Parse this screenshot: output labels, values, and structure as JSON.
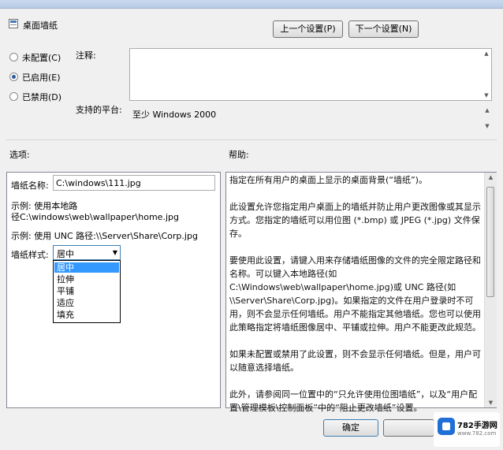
{
  "header": {
    "setting_title": "桌面墙纸",
    "prev_button": "上一个设置(P)",
    "next_button": "下一个设置(N)"
  },
  "state": {
    "not_configured": "未配置(C)",
    "enabled": "已启用(E)",
    "disabled": "已禁用(D)",
    "selected": "enabled"
  },
  "comment": {
    "label": "注释:",
    "value": ""
  },
  "platform": {
    "label": "支持的平台:",
    "value": "至少 Windows 2000"
  },
  "options": {
    "label": "选项:",
    "wallpaper_name_label": "墙纸名称:",
    "wallpaper_name_value": "C:\\windows\\111.jpg",
    "example_local_line1": "示例: 使用本地路",
    "example_local_line2": "径C:\\windows\\web\\wallpaper\\home.jpg",
    "example_unc": "示例: 使用 UNC 路径:\\\\Server\\Share\\Corp.jpg",
    "style_label": "墙纸样式:",
    "style_value": "居中",
    "style_options": [
      "居中",
      "拉伸",
      "平铺",
      "适应",
      "填充"
    ]
  },
  "help": {
    "label": "帮助:",
    "paragraphs": [
      "指定在所有用户的桌面上显示的桌面背景(“墙纸”)。",
      "此设置允许您指定用户桌面上的墙纸并防止用户更改图像或其显示方式。您指定的墙纸可以用位图 (*.bmp) 或 JPEG (*.jpg) 文件保存。",
      "要使用此设置，请键入用来存储墙纸图像的文件的完全限定路径和名称。可以键入本地路径(如 C:\\Windows\\web\\wallpaper\\home.jpg)或 UNC 路径(如 \\\\Server\\Share\\Corp.jpg)。如果指定的文件在用户登录时不可用，则不会显示任何墙纸。用户不能指定其他墙纸。您也可以使用此策略指定将墙纸图像居中、平铺或拉伸。用户不能更改此规范。",
      "如果未配置或禁用了此设置，则不会显示任何墙纸。但是，用户可以随意选择墙纸。",
      "此外，请参阅同一位置中的“只允许使用位图墙纸”，以及“用户配置\\管理模板\\控制面板”中的“阻止更改墙纸”设置。"
    ]
  },
  "footer": {
    "ok_button": "确定"
  },
  "watermark": {
    "brand": "782手游网",
    "url": "www.782.com"
  }
}
